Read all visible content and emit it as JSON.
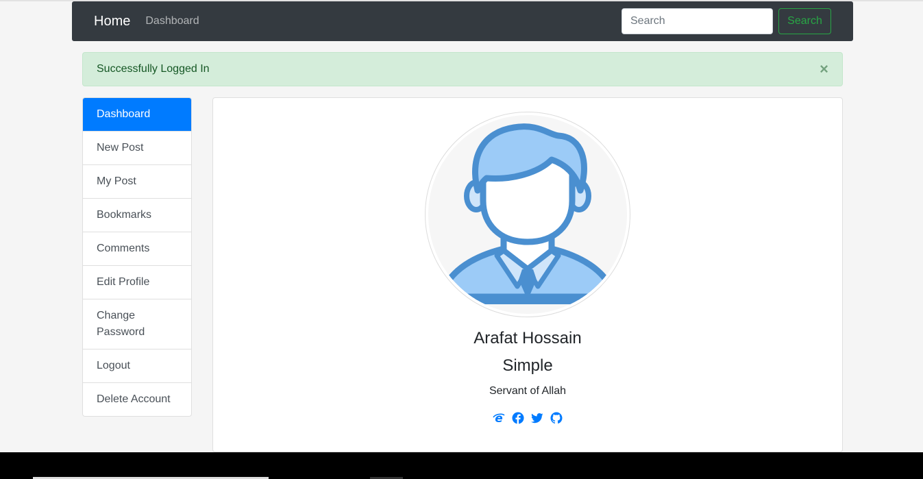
{
  "navbar": {
    "brand": "Home",
    "links": [
      "Dashboard"
    ],
    "search_placeholder": "Search",
    "search_button": "Search"
  },
  "alert": {
    "message": "Successfully Logged In",
    "close": "×"
  },
  "sidebar": {
    "items": [
      {
        "label": "Dashboard",
        "active": true
      },
      {
        "label": "New Post"
      },
      {
        "label": "My Post"
      },
      {
        "label": "Bookmarks"
      },
      {
        "label": "Comments"
      },
      {
        "label": "Edit Profile"
      },
      {
        "label": "Change Password"
      },
      {
        "label": "Logout"
      },
      {
        "label": "Delete Account"
      }
    ]
  },
  "profile": {
    "name": "Arafat Hossain",
    "role": "Simple",
    "bio": "Servant of Allah",
    "socials": [
      "website-icon",
      "facebook-icon",
      "twitter-icon",
      "github-icon"
    ]
  },
  "colors": {
    "navbar_bg": "#343a40",
    "accent": "#007bff",
    "success": "#28a745",
    "alert_bg": "#d4edda",
    "alert_text": "#155724"
  }
}
